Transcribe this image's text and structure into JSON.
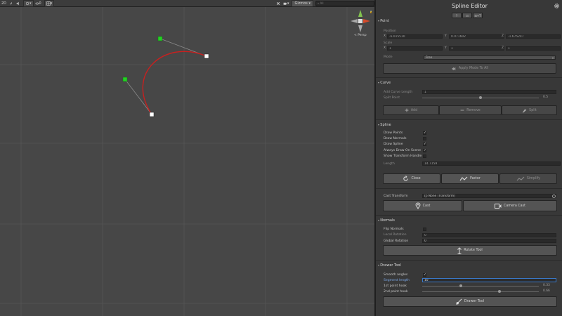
{
  "scene_toolbar": {
    "mode_label": "2D",
    "gizmos_label": "Gizmos",
    "search_placeholder": "All",
    "persp_label": "< Persp"
  },
  "panel": {
    "title": "Spline Editor",
    "title_buttons": [
      "?",
      "⊡",
      "⊞+T"
    ],
    "point": {
      "header": "Point",
      "position_label": "Position",
      "position": {
        "x": "-6.015510",
        "y": "0.071602",
        "z": "-1.675247"
      },
      "scale_label": "Scale",
      "scale": {
        "x": "1",
        "y": "1",
        "z": "1"
      },
      "mode_label": "Mode",
      "mode_value": "Free",
      "apply_mode_label": "Apply Mode To All"
    },
    "curve": {
      "header": "Curve",
      "add_curve_length_label": "Add Curve Length",
      "add_curve_length_value": "1",
      "split_point_label": "Split Point",
      "split_point_value": 0.5,
      "split_point_text": "0.5",
      "add_label": "Add",
      "remove_label": "Remove",
      "split_label": "Split"
    },
    "spline": {
      "header": "Spline",
      "checks": [
        {
          "label": "Draw Points",
          "checked": true
        },
        {
          "label": "Draw Normals",
          "checked": false
        },
        {
          "label": "Draw Spline",
          "checked": true
        },
        {
          "label": "Always Draw On Scene",
          "checked": true
        },
        {
          "label": "Show Transform Handle",
          "checked": false
        }
      ],
      "length_label": "Length",
      "length_value": "14.7159",
      "close_label": "Close",
      "factor_label": "Factor",
      "simplify_label": "Simplify"
    },
    "cast": {
      "cast_transform_label": "Cast Transform",
      "cast_transform_value": "⨀ None (Transform)",
      "cast_label": "Cast",
      "camera_cast_label": "Camera Cast"
    },
    "normals": {
      "header": "Normals",
      "flip_normals_label": "Flip Normals",
      "flip_normals_checked": false,
      "local_rotation_label": "Local Rotation",
      "local_rotation_value": "0",
      "global_rotation_label": "Global Rotation",
      "global_rotation_value": "0",
      "rotate_tool_label": "Rotate Tool"
    },
    "drawer": {
      "header": "Drawer Tool",
      "smooth_angles_label": "Smooth angles",
      "smooth_angles_checked": true,
      "segment_length_label": "Segment length",
      "segment_length_value": "10",
      "hook1_label": "1st point hook",
      "hook1_value": 0.33,
      "hook1_text": "0.33",
      "hook2_label": "2nd point hook",
      "hook2_value": 0.66,
      "hook2_text": "0.66",
      "drawer_tool_label": "Drawer Tool"
    }
  },
  "colors": {
    "scene_bg": "#474747",
    "panel_bg": "#383838",
    "spline_red": "#c8201f",
    "handle_green": "#23d223",
    "accent_blue": "#3a79c9"
  }
}
